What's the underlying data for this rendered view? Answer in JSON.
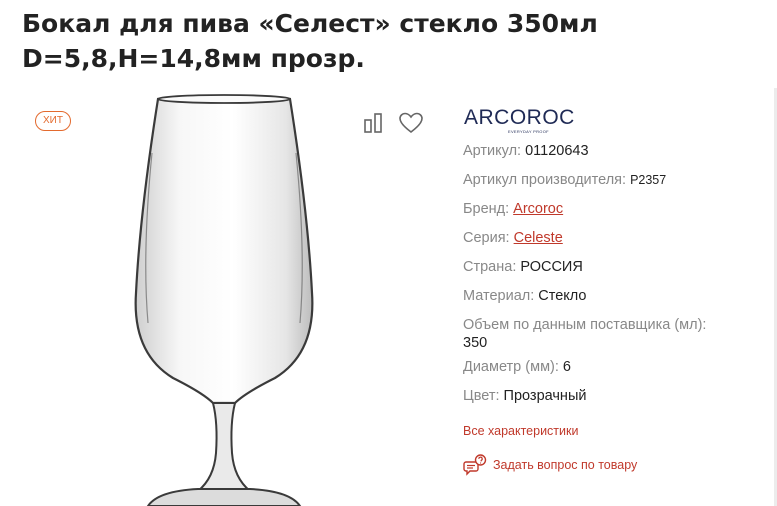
{
  "product": {
    "title": "Бокал для пива «Селест» стекло 350мл D=5,8,H=14,8мм прозр.",
    "badge": "хит",
    "brand_logo": "ARCOROC",
    "brand_tagline": "EVERYDAY PROOF"
  },
  "props": [
    {
      "key": "Артикул:",
      "value": "01120643"
    },
    {
      "key": "Артикул производителя:",
      "value": "P2357"
    },
    {
      "key": "Бренд:",
      "value": "Arcoroc"
    },
    {
      "key": "Серия:",
      "value": "Celeste"
    },
    {
      "key": "Страна:",
      "value": "РОССИЯ"
    },
    {
      "key": "Материал:",
      "value": "Стекло"
    },
    {
      "key": "Объем по данным поставщика (мл):",
      "value": "350"
    },
    {
      "key": "Диаметр (мм):",
      "value": "6"
    },
    {
      "key": "Цвет:",
      "value": "Прозрачный"
    }
  ],
  "links": {
    "all_specs": "Все характеристики",
    "ask_question": "Задать вопрос по товару"
  },
  "icons": {
    "compare": "compare-icon",
    "favorite": "heart-icon",
    "question": "chat-question-icon"
  },
  "colors": {
    "accent": "#c0392b",
    "badge": "#e36a2e",
    "brand": "#1f2a55"
  }
}
